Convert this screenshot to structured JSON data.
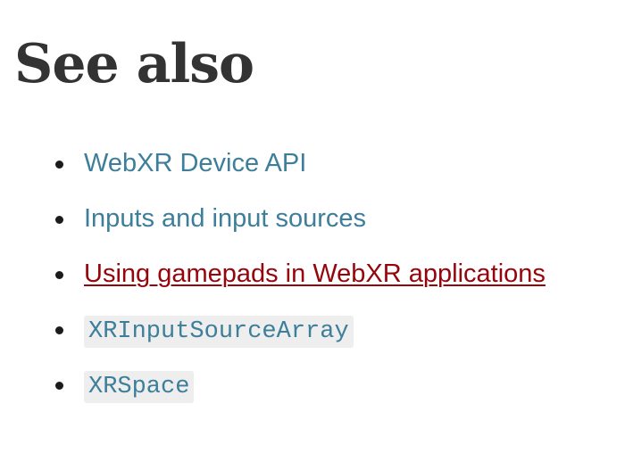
{
  "section": {
    "heading": "See also"
  },
  "links": [
    {
      "label": "WebXR Device API",
      "style": "text",
      "color": "#3d7e9a"
    },
    {
      "label": "Inputs and input sources",
      "style": "text",
      "color": "#3d7e9a"
    },
    {
      "label": "Using gamepads in WebXR applications",
      "style": "visited",
      "color": "#95050c"
    },
    {
      "label": "XRInputSourceArray",
      "style": "code",
      "color": "#3d7e9a"
    },
    {
      "label": "XRSpace",
      "style": "code",
      "color": "#3d7e9a"
    }
  ]
}
